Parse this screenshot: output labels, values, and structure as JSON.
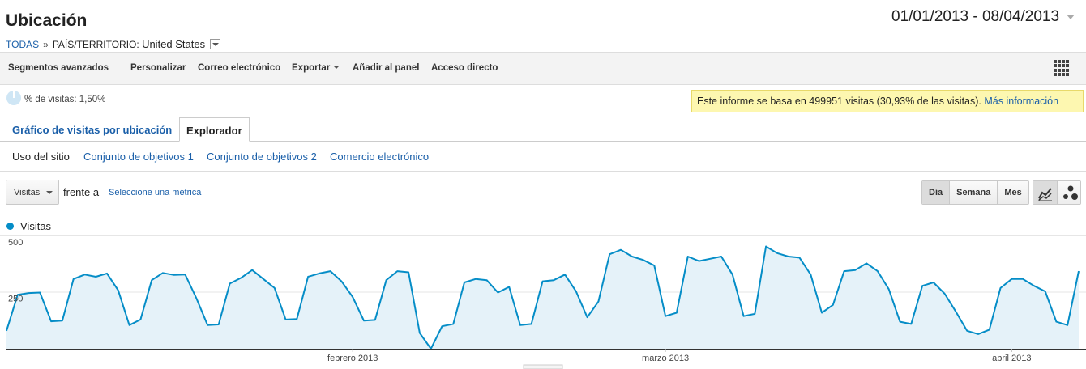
{
  "header": {
    "title": "Ubicación",
    "date_range": "01/01/2013 - 08/04/2013"
  },
  "breadcrumb": {
    "root": "TODAS",
    "separator": "»",
    "dimension_label": "PAÍS/TERRITORIO:",
    "dimension_value": "United States"
  },
  "toolbar": {
    "advanced_segments": "Segmentos avanzados",
    "customize": "Personalizar",
    "email": "Correo electrónico",
    "export": "Exportar",
    "add_to_dashboard": "Añadir al panel",
    "shortcut": "Acceso directo",
    "icons": {
      "grid": "grid-icon",
      "export_caret": "chevron-down-icon"
    }
  },
  "sampling": {
    "percent_label": "% de visitas: 1,50%",
    "notice": "Este informe se basa en 499951 visitas (30,93% de las visitas).",
    "more_info": "Más información"
  },
  "tabs": [
    {
      "label": "Gráfico de visitas por ubicación",
      "active": false
    },
    {
      "label": "Explorador",
      "active": true
    }
  ],
  "subtabs": [
    {
      "label": "Uso del sitio",
      "active": true
    },
    {
      "label": "Conjunto de objetivos 1",
      "active": false
    },
    {
      "label": "Conjunto de objetivos 2",
      "active": false
    },
    {
      "label": "Comercio electrónico",
      "active": false
    }
  ],
  "controls": {
    "metric": "Visitas",
    "versus": "frente a",
    "select_metric": "Seleccione una métrica",
    "periods": [
      "Día",
      "Semana",
      "Mes"
    ],
    "active_period": "Día",
    "views": [
      "line-chart-icon",
      "motion-chart-icon"
    ]
  },
  "colors": {
    "series": "#058dc7",
    "fill": "#e5f2f9",
    "link": "#1a5fa9",
    "notice_bg": "#fdf7b0"
  },
  "chart_data": {
    "type": "area",
    "series": [
      {
        "name": "Visitas",
        "values": [
          80,
          240,
          248,
          250,
          122,
          125,
          310,
          330,
          320,
          335,
          260,
          105,
          130,
          305,
          337,
          328,
          330,
          225,
          105,
          108,
          290,
          315,
          350,
          310,
          270,
          130,
          132,
          320,
          335,
          345,
          300,
          230,
          125,
          128,
          305,
          345,
          340,
          70,
          0,
          100,
          110,
          295,
          310,
          305,
          250,
          275,
          105,
          110,
          300,
          305,
          330,
          255,
          140,
          210,
          420,
          440,
          410,
          395,
          370,
          145,
          160,
          410,
          390,
          400,
          410,
          330,
          145,
          155,
          455,
          425,
          410,
          405,
          330,
          160,
          195,
          345,
          350,
          380,
          345,
          265,
          120,
          110,
          280,
          295,
          245,
          165,
          80,
          65,
          85,
          270,
          310,
          310,
          280,
          255,
          120,
          105,
          345
        ]
      }
    ],
    "x_start": "2013-01-01",
    "x_end": "2013-04-08",
    "x_ticks": [
      {
        "label": "febrero 2013",
        "date": "2013-02-01"
      },
      {
        "label": "marzo 2013",
        "date": "2013-03-01"
      },
      {
        "label": "abril 2013",
        "date": "2013-04-01"
      }
    ],
    "y_ticks": [
      500,
      250
    ],
    "ylim": [
      0,
      500
    ],
    "grid": true,
    "legend": "top-left"
  }
}
